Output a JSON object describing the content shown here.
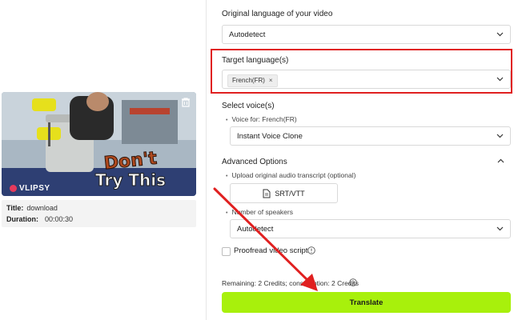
{
  "video": {
    "watermark": "VLIPSY",
    "caption_line1": "Don't",
    "caption_line2": "Try This",
    "title_label": "Title:",
    "title_value": "download",
    "duration_label": "Duration:",
    "duration_value": "00:00:30"
  },
  "form": {
    "original_language_label": "Original language of your video",
    "original_language_value": "Autodetect",
    "target_language_label": "Target language(s)",
    "target_language_tag": "French(FR)",
    "target_tag_remove": "×",
    "select_voice_label": "Select voice(s)",
    "voice_for_label": "Voice for: French(FR)",
    "voice_value": "Instant Voice Clone",
    "advanced_options_label": "Advanced Options",
    "upload_transcript_label": "Upload original audio transcript (optional)",
    "srt_button_label": "SRT/VTT",
    "speakers_label": "Number of speakers",
    "speakers_value": "Autodetect",
    "proofread_label": "Proofread video script",
    "credits_text": "Remaining: 2 Credits; consumption: 2 Credits",
    "translate_button_label": "Translate"
  },
  "colors": {
    "accent_green": "#a8f00c",
    "highlight_red": "#e02020",
    "arrow_red": "#e02020"
  },
  "icons": [
    "trash-icon",
    "chevron-down-icon",
    "chevron-up-icon",
    "file-icon",
    "help-circle-icon",
    "info-icon",
    "arrow-annotation"
  ]
}
